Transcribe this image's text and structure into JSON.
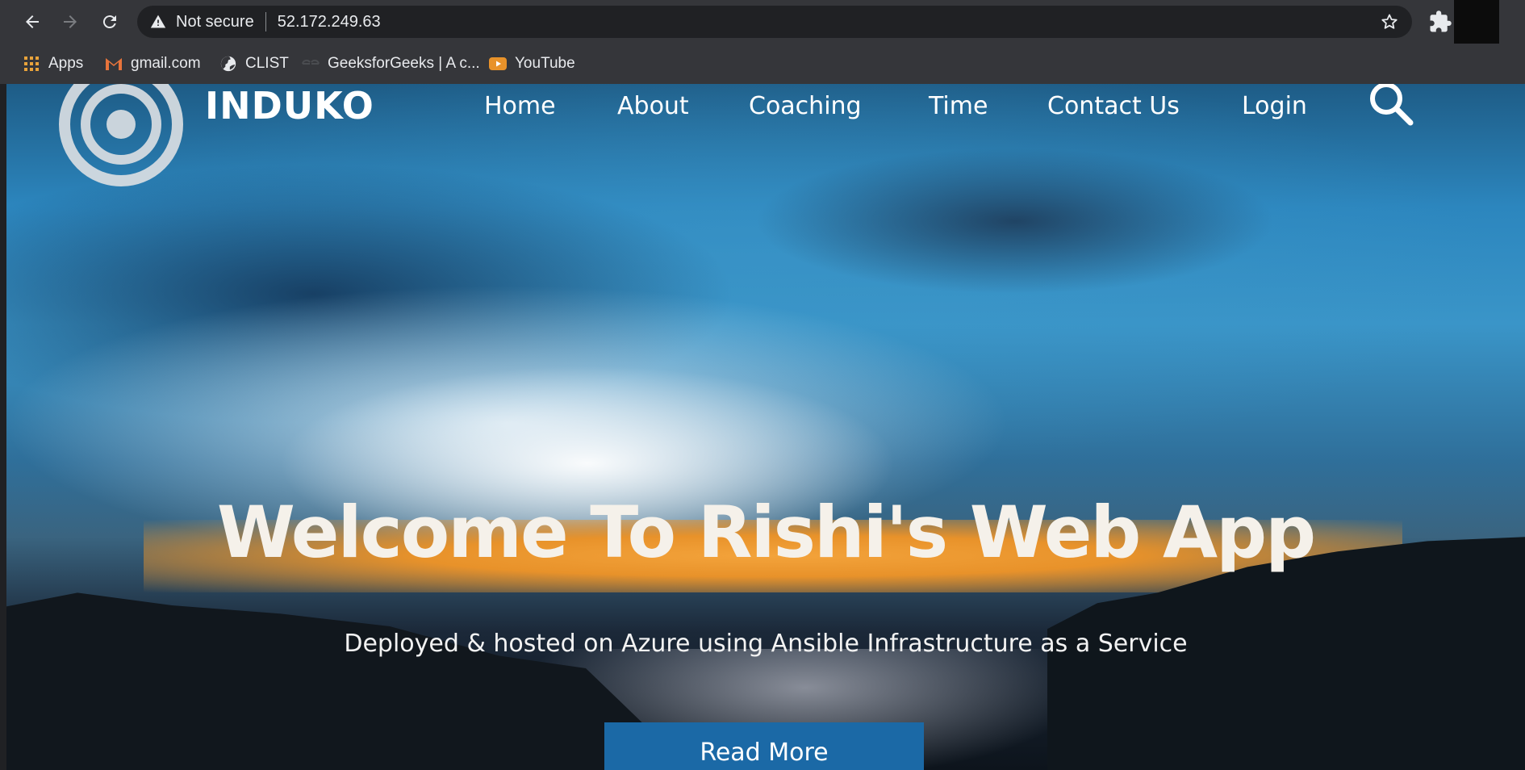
{
  "browser": {
    "security_text": "Not secure",
    "url": "52.172.249.63"
  },
  "bookmarks": [
    {
      "label": "Apps",
      "icon": "apps-grid-icon"
    },
    {
      "label": "gmail.com",
      "icon": "gmail-icon"
    },
    {
      "label": "CLIST",
      "icon": "globe-icon"
    },
    {
      "label": "GeeksforGeeks | A c...",
      "icon": "geeksforgeeks-icon"
    },
    {
      "label": "YouTube",
      "icon": "youtube-icon"
    }
  ],
  "site": {
    "brand": "INDUKO",
    "nav": [
      "Home",
      "About",
      "Coaching",
      "Time",
      "Contact Us",
      "Login"
    ]
  },
  "hero": {
    "title": "Welcome To Rishi's Web App",
    "subtitle": "Deployed & hosted on Azure using Ansible Infrastructure as a Service",
    "button": "Read More"
  },
  "colors": {
    "chrome": "#35363a",
    "button": "#1b69a6",
    "horizon": "#e8922a"
  }
}
